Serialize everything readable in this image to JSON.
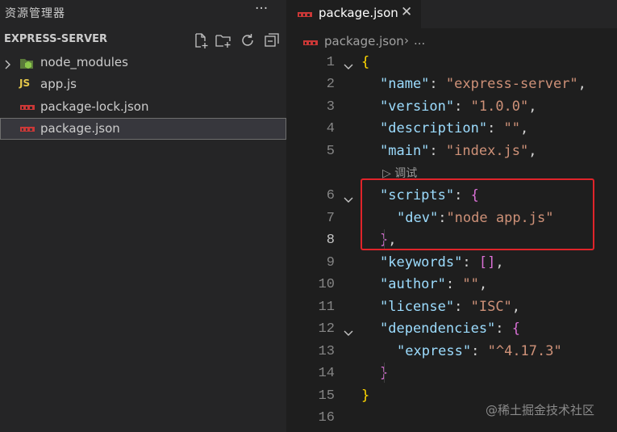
{
  "sidebar": {
    "title": "资源管理器",
    "more_label": "···",
    "section_title": "EXPRESS-SERVER",
    "actions": [
      {
        "icon": "new-file-icon"
      },
      {
        "icon": "new-folder-icon"
      },
      {
        "icon": "refresh-icon"
      },
      {
        "icon": "collapse-all-icon"
      }
    ],
    "items": [
      {
        "label": "node_modules",
        "icon": "node-folder-icon",
        "type": "folder",
        "collapsed": true
      },
      {
        "label": "app.js",
        "icon": "js-file-icon",
        "icon_text": "JS"
      },
      {
        "label": "package-lock.json",
        "icon": "npm-file-icon"
      },
      {
        "label": "package.json",
        "icon": "npm-file-icon",
        "selected": true
      }
    ]
  },
  "tab": {
    "label": "package.json",
    "close_label": "✕"
  },
  "breadcrumb": {
    "file": "package.json",
    "separator": "›",
    "more": "..."
  },
  "editor": {
    "codelens": "▷ 调试",
    "active_line": 8,
    "lines": [
      {
        "n": "1",
        "code": "{"
      },
      {
        "n": "2",
        "key": "\"name\"",
        "value": "\"express-server\""
      },
      {
        "n": "3",
        "key": "\"version\"",
        "value": "\"1.0.0\""
      },
      {
        "n": "4",
        "key": "\"description\"",
        "value": "\"\""
      },
      {
        "n": "5",
        "key": "\"main\"",
        "value": "\"index.js\""
      },
      {
        "n": "6",
        "key": "\"scripts\"",
        "open": "{"
      },
      {
        "n": "7",
        "key": "\"dev\"",
        "value": "\"node app.js\""
      },
      {
        "n": "8",
        "close": "}",
        "comma": ","
      },
      {
        "n": "9",
        "key": "\"keywords\"",
        "value": "[]"
      },
      {
        "n": "10",
        "key": "\"author\"",
        "value": "\"\""
      },
      {
        "n": "11",
        "key": "\"license\"",
        "value": "\"ISC\""
      },
      {
        "n": "12",
        "key": "\"dependencies\"",
        "open": "{"
      },
      {
        "n": "13",
        "key": "\"express\"",
        "value": "\"^4.17.3\""
      },
      {
        "n": "14",
        "close": "}"
      },
      {
        "n": "15",
        "code": "}"
      },
      {
        "n": "16"
      }
    ]
  },
  "watermark": "@稀土掘金技术社区",
  "colors": {
    "key": "#9cdcfe",
    "string": "#ce9178",
    "bracket_yellow": "#ffd700",
    "bracket_purple": "#da70d6",
    "highlight_box": "#e0242a",
    "npm_icon": "#cb3837",
    "js_icon": "#e6c84a",
    "node_icon": "#8cc84b"
  }
}
